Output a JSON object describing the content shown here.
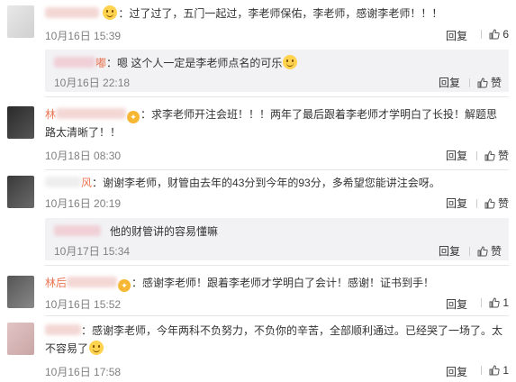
{
  "actions": {
    "reply": "回复",
    "like_label": "赞"
  },
  "comments": [
    {
      "user": "",
      "text": "：过了过了，五门一起过，李老师保佑，李老师，感谢李老师！！！",
      "time": "10月16日 15:39",
      "likes": "6",
      "emoji": "grinning-emoji",
      "sub": {
        "user": "嘟",
        "text": "：嗯 这个人一定是李老师点名的可乐",
        "time": "10月16日 22:18",
        "likes": "赞"
      }
    },
    {
      "user": "林",
      "text": "：求李老师开注会班！！！两年了最后跟着李老师才学明白了长投！解题思路太清晰了！！",
      "time": "10月18日 08:30",
      "likes": "赞"
    },
    {
      "user": "风",
      "text": "：谢谢李老师，财管由去年的43分到今年的93分，多希望您能讲注会呀。",
      "time": "10月16日 20:19",
      "likes": "赞",
      "sub": {
        "user": "",
        "text": "他的财管讲的容易懂嘛",
        "time": "10月17日 15:34",
        "likes": "赞"
      }
    },
    {
      "user": "林后",
      "text": "：感谢李老师！跟着李老师才学明白了会计！感谢！证书到手！",
      "time": "10月16日 15:52",
      "likes": "1"
    },
    {
      "user": "",
      "text": "：感谢李老师，今年两科不负努力，不负你的辛苦，全部顺利通过。已经哭了一场了。太不容易了",
      "time": "10月16日 17:58",
      "likes": "1"
    }
  ]
}
